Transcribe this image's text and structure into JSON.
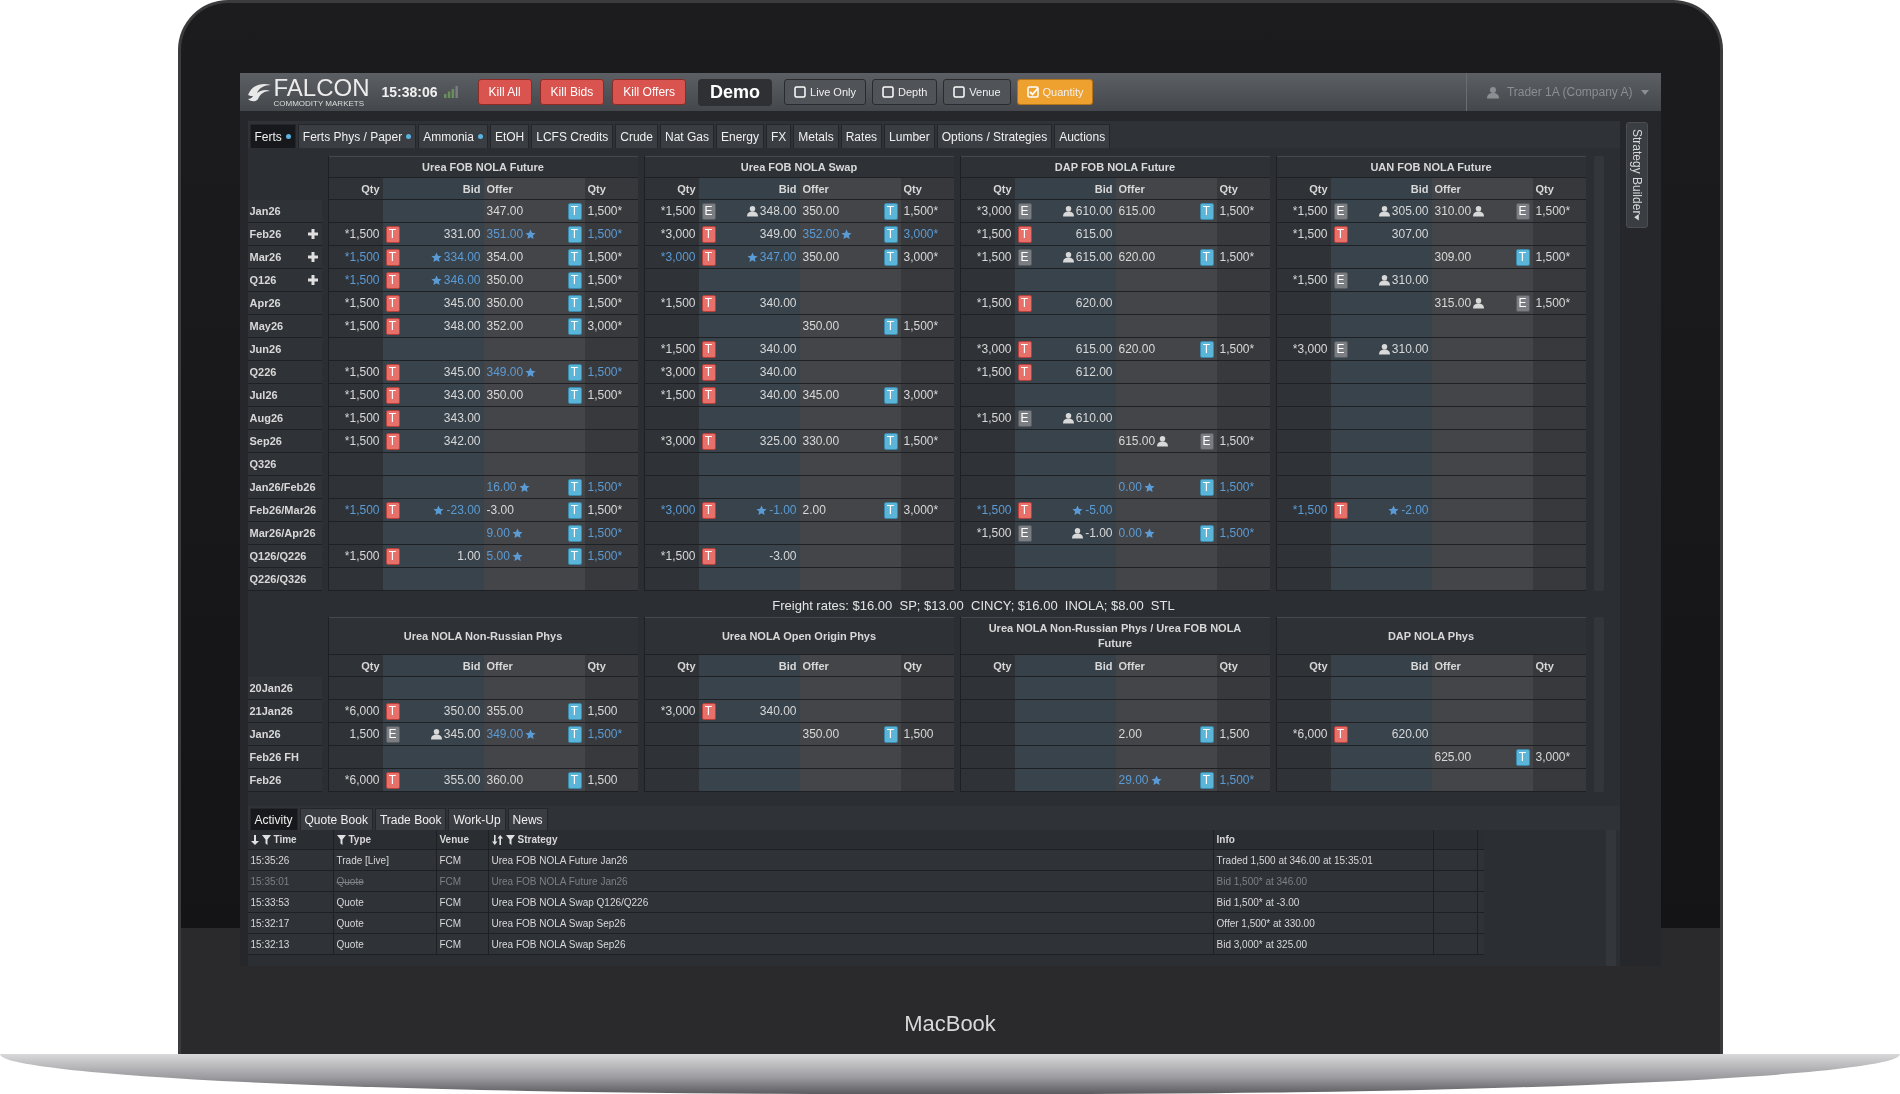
{
  "app": {
    "logo": {
      "name": "FALCON",
      "tagline": "COMMODITY MARKETS"
    },
    "clock": "15:38:06",
    "kill_buttons": [
      "Kill All",
      "Kill Bids",
      "Kill Offers"
    ],
    "mode": "Demo",
    "toggles": [
      {
        "label": "Live Only",
        "checked": false
      },
      {
        "label": "Depth",
        "checked": false
      },
      {
        "label": "Venue",
        "checked": false
      },
      {
        "label": "Quantity",
        "checked": true
      }
    ],
    "user": "Trader 1A (Company A)"
  },
  "tabs": [
    {
      "label": "Ferts",
      "selected": true,
      "alert": true
    },
    {
      "label": "Ferts Phys / Paper",
      "selected": false,
      "alert": true
    },
    {
      "label": "Ammonia",
      "selected": false,
      "alert": true
    },
    {
      "label": "EtOH",
      "selected": false,
      "alert": false
    },
    {
      "label": "LCFS Credits",
      "selected": false,
      "alert": false
    },
    {
      "label": "Crude",
      "selected": false,
      "alert": false
    },
    {
      "label": "Nat Gas",
      "selected": false,
      "alert": false
    },
    {
      "label": "Energy",
      "selected": false,
      "alert": false
    },
    {
      "label": "FX",
      "selected": false,
      "alert": false
    },
    {
      "label": "Metals",
      "selected": false,
      "alert": false
    },
    {
      "label": "Rates",
      "selected": false,
      "alert": false
    },
    {
      "label": "Lumber",
      "selected": false,
      "alert": false
    },
    {
      "label": "Options / Strategies",
      "selected": false,
      "alert": false
    },
    {
      "label": "Auctions",
      "selected": false,
      "alert": false
    }
  ],
  "side_panel": {
    "label": "Strategy Builder"
  },
  "upper": {
    "markets": [
      {
        "title": "Urea FOB NOLA Future",
        "columns": [
          "Qty",
          "Bid",
          "Offer",
          "Qty"
        ]
      },
      {
        "title": "Urea FOB NOLA Swap",
        "columns": [
          "Qty",
          "Bid",
          "Offer",
          "Qty"
        ]
      },
      {
        "title": "DAP FOB NOLA Future",
        "columns": [
          "Qty",
          "Bid",
          "Offer",
          "Qty"
        ]
      },
      {
        "title": "UAN FOB NOLA Future",
        "columns": [
          "Qty",
          "Bid",
          "Offer",
          "Qty"
        ]
      }
    ],
    "rows": [
      {
        "label": "Jan26",
        "expandable": false,
        "cells": [
          {
            "offer": {
              "price": "347.00",
              "tag": "T",
              "tag_muted": false,
              "qty": "1,500*"
            }
          },
          {
            "bid": {
              "qty": "*1,500",
              "tag": "E",
              "tag_muted": true,
              "price": "348.00",
              "kind": "named"
            },
            "offer": {
              "price": "350.00",
              "tag": "T",
              "tag_muted": false,
              "qty": "1,500*"
            }
          },
          {
            "bid": {
              "qty": "*3,000",
              "tag": "E",
              "tag_muted": true,
              "price": "610.00",
              "kind": "named"
            },
            "offer": {
              "price": "615.00",
              "tag": "T",
              "tag_muted": false,
              "qty": "1,500*"
            }
          },
          {
            "bid": {
              "qty": "*1,500",
              "tag": "E",
              "tag_muted": true,
              "price": "305.00",
              "kind": "named"
            },
            "offer": {
              "price": "310.00",
              "kind": "named",
              "tag": "E",
              "tag_muted": true,
              "qty": "1,500*"
            }
          }
        ]
      },
      {
        "label": "Feb26",
        "expandable": true,
        "cells": [
          {
            "bid": {
              "qty": "*1,500",
              "tag": "T",
              "tag_muted": false,
              "price": "331.00"
            },
            "offer": {
              "price": "351.00",
              "kind": "own",
              "tag": "T",
              "tag_muted": false,
              "qty": "1,500*"
            }
          },
          {
            "bid": {
              "qty": "*3,000",
              "tag": "T",
              "tag_muted": false,
              "price": "349.00"
            },
            "offer": {
              "price": "352.00",
              "kind": "own",
              "tag": "T",
              "tag_muted": false,
              "qty": "3,000*"
            }
          },
          {
            "bid": {
              "qty": "*1,500",
              "tag": "T",
              "tag_muted": false,
              "price": "615.00"
            }
          },
          {
            "bid": {
              "qty": "*1,500",
              "tag": "T",
              "tag_muted": false,
              "price": "307.00"
            }
          }
        ]
      },
      {
        "label": "Mar26",
        "expandable": true,
        "cells": [
          {
            "bid": {
              "qty": "*1,500",
              "tag": "T",
              "tag_muted": false,
              "price": "334.00",
              "kind": "own"
            },
            "offer": {
              "price": "354.00",
              "tag": "T",
              "tag_muted": false,
              "qty": "1,500*"
            }
          },
          {
            "bid": {
              "qty": "*3,000",
              "tag": "T",
              "tag_muted": false,
              "price": "347.00",
              "kind": "own"
            },
            "offer": {
              "price": "350.00",
              "tag": "T",
              "tag_muted": false,
              "qty": "3,000*"
            }
          },
          {
            "bid": {
              "qty": "*1,500",
              "tag": "E",
              "tag_muted": true,
              "price": "615.00",
              "kind": "named"
            },
            "offer": {
              "price": "620.00",
              "tag": "T",
              "tag_muted": false,
              "qty": "1,500*"
            }
          },
          {
            "offer": {
              "price": "309.00",
              "tag": "T",
              "tag_muted": false,
              "qty": "1,500*"
            }
          }
        ]
      },
      {
        "label": "Q126",
        "expandable": true,
        "cells": [
          {
            "bid": {
              "qty": "*1,500",
              "tag": "T",
              "tag_muted": false,
              "price": "346.00",
              "kind": "own"
            },
            "offer": {
              "price": "350.00",
              "tag": "T",
              "tag_muted": false,
              "qty": "1,500*"
            }
          },
          null,
          null,
          {
            "bid": {
              "qty": "*1,500",
              "tag": "E",
              "tag_muted": true,
              "price": "310.00",
              "kind": "named"
            }
          }
        ]
      },
      {
        "label": "Apr26",
        "expandable": false,
        "cells": [
          {
            "bid": {
              "qty": "*1,500",
              "tag": "T",
              "tag_muted": false,
              "price": "345.00"
            },
            "offer": {
              "price": "350.00",
              "tag": "T",
              "tag_muted": false,
              "qty": "1,500*"
            }
          },
          {
            "bid": {
              "qty": "*1,500",
              "tag": "T",
              "tag_muted": false,
              "price": "340.00"
            }
          },
          {
            "bid": {
              "qty": "*1,500",
              "tag": "T",
              "tag_muted": false,
              "price": "620.00"
            }
          },
          {
            "offer": {
              "price": "315.00",
              "kind": "named",
              "tag": "E",
              "tag_muted": true,
              "qty": "1,500*"
            }
          }
        ]
      },
      {
        "label": "May26",
        "expandable": false,
        "cells": [
          {
            "bid": {
              "qty": "*1,500",
              "tag": "T",
              "tag_muted": false,
              "price": "348.00"
            },
            "offer": {
              "price": "352.00",
              "tag": "T",
              "tag_muted": false,
              "qty": "3,000*"
            }
          },
          {
            "offer": {
              "price": "350.00",
              "tag": "T",
              "tag_muted": false,
              "qty": "1,500*"
            }
          },
          null,
          null
        ]
      },
      {
        "label": "Jun26",
        "expandable": false,
        "cells": [
          null,
          {
            "bid": {
              "qty": "*1,500",
              "tag": "T",
              "tag_muted": false,
              "price": "340.00"
            }
          },
          {
            "bid": {
              "qty": "*3,000",
              "tag": "T",
              "tag_muted": false,
              "price": "615.00"
            },
            "offer": {
              "price": "620.00",
              "tag": "T",
              "tag_muted": false,
              "qty": "1,500*"
            }
          },
          {
            "bid": {
              "qty": "*3,000",
              "tag": "E",
              "tag_muted": true,
              "price": "310.00",
              "kind": "named"
            }
          }
        ]
      },
      {
        "label": "Q226",
        "expandable": false,
        "cells": [
          {
            "bid": {
              "qty": "*1,500",
              "tag": "T",
              "tag_muted": false,
              "price": "345.00"
            },
            "offer": {
              "price": "349.00",
              "kind": "own",
              "tag": "T",
              "tag_muted": false,
              "qty": "1,500*"
            }
          },
          {
            "bid": {
              "qty": "*3,000",
              "tag": "T",
              "tag_muted": false,
              "price": "340.00"
            }
          },
          {
            "bid": {
              "qty": "*1,500",
              "tag": "T",
              "tag_muted": false,
              "price": "612.00"
            }
          },
          null
        ]
      },
      {
        "label": "Jul26",
        "expandable": false,
        "cells": [
          {
            "bid": {
              "qty": "*1,500",
              "tag": "T",
              "tag_muted": false,
              "price": "343.00"
            },
            "offer": {
              "price": "350.00",
              "tag": "T",
              "tag_muted": false,
              "qty": "1,500*"
            }
          },
          {
            "bid": {
              "qty": "*1,500",
              "tag": "T",
              "tag_muted": false,
              "price": "340.00"
            },
            "offer": {
              "price": "345.00",
              "tag": "T",
              "tag_muted": false,
              "qty": "3,000*"
            }
          },
          null,
          null
        ]
      },
      {
        "label": "Aug26",
        "expandable": false,
        "cells": [
          {
            "bid": {
              "qty": "*1,500",
              "tag": "T",
              "tag_muted": false,
              "price": "343.00"
            }
          },
          null,
          {
            "bid": {
              "qty": "*1,500",
              "tag": "E",
              "tag_muted": true,
              "price": "610.00",
              "kind": "named"
            }
          },
          null
        ]
      },
      {
        "label": "Sep26",
        "expandable": false,
        "cells": [
          {
            "bid": {
              "qty": "*1,500",
              "tag": "T",
              "tag_muted": false,
              "price": "342.00"
            }
          },
          {
            "bid": {
              "qty": "*3,000",
              "tag": "T",
              "tag_muted": false,
              "price": "325.00"
            },
            "offer": {
              "price": "330.00",
              "tag": "T",
              "tag_muted": false,
              "qty": "1,500*"
            }
          },
          {
            "offer": {
              "price": "615.00",
              "kind": "named",
              "tag": "E",
              "tag_muted": true,
              "qty": "1,500*"
            }
          },
          null
        ]
      },
      {
        "label": "Q326",
        "expandable": false,
        "cells": [
          null,
          null,
          null,
          null
        ]
      },
      {
        "label": "Jan26/Feb26",
        "expandable": false,
        "cells": [
          {
            "offer": {
              "price": "16.00",
              "kind": "own",
              "tag": "T",
              "tag_muted": false,
              "qty": "1,500*"
            }
          },
          null,
          {
            "offer": {
              "price": "0.00",
              "kind": "own",
              "tag": "T",
              "tag_muted": false,
              "qty": "1,500*"
            }
          },
          null
        ]
      },
      {
        "label": "Feb26/Mar26",
        "expandable": false,
        "cells": [
          {
            "bid": {
              "qty": "*1,500",
              "tag": "T",
              "tag_muted": false,
              "price": "-23.00",
              "kind": "own"
            },
            "offer": {
              "price": "-3.00",
              "tag": "T",
              "tag_muted": false,
              "qty": "1,500*"
            }
          },
          {
            "bid": {
              "qty": "*3,000",
              "tag": "T",
              "tag_muted": false,
              "price": "-1.00",
              "kind": "own"
            },
            "offer": {
              "price": "2.00",
              "tag": "T",
              "tag_muted": false,
              "qty": "3,000*"
            }
          },
          {
            "bid": {
              "qty": "*1,500",
              "tag": "T",
              "tag_muted": false,
              "price": "-5.00",
              "kind": "own"
            }
          },
          {
            "bid": {
              "qty": "*1,500",
              "tag": "T",
              "tag_muted": false,
              "price": "-2.00",
              "kind": "own"
            }
          }
        ]
      },
      {
        "label": "Mar26/Apr26",
        "expandable": false,
        "cells": [
          {
            "offer": {
              "price": "9.00",
              "kind": "own",
              "tag": "T",
              "tag_muted": false,
              "qty": "1,500*"
            }
          },
          null,
          {
            "bid": {
              "qty": "*1,500",
              "tag": "E",
              "tag_muted": true,
              "price": "-1.00",
              "kind": "named"
            },
            "offer": {
              "price": "0.00",
              "kind": "own",
              "tag": "T",
              "tag_muted": false,
              "qty": "1,500*"
            }
          },
          null
        ]
      },
      {
        "label": "Q126/Q226",
        "expandable": false,
        "cells": [
          {
            "bid": {
              "qty": "*1,500",
              "tag": "T",
              "tag_muted": false,
              "price": "1.00"
            },
            "offer": {
              "price": "5.00",
              "kind": "own",
              "tag": "T",
              "tag_muted": false,
              "qty": "1,500*"
            }
          },
          {
            "bid": {
              "qty": "*1,500",
              "tag": "T",
              "tag_muted": false,
              "price": "-3.00"
            }
          },
          null,
          null
        ]
      },
      {
        "label": "Q226/Q326",
        "expandable": false,
        "cells": [
          null,
          null,
          null,
          null
        ]
      }
    ]
  },
  "freight": "Freight rates: $16.00  SP; $13.00  CINCY; $16.00  INOLA; $8.00  STL",
  "lower": {
    "markets": [
      {
        "title": "Urea NOLA Non-Russian Phys",
        "columns": [
          "Qty",
          "Bid",
          "Offer",
          "Qty"
        ]
      },
      {
        "title": "Urea NOLA Open Origin Phys",
        "columns": [
          "Qty",
          "Bid",
          "Offer",
          "Qty"
        ]
      },
      {
        "title": "Urea NOLA Non-Russian Phys / Urea FOB NOLA Future",
        "columns": [
          "Qty",
          "Bid",
          "Offer",
          "Qty"
        ]
      },
      {
        "title": "DAP NOLA Phys",
        "columns": [
          "Qty",
          "Bid",
          "Offer",
          "Qty"
        ]
      }
    ],
    "rows": [
      {
        "label": "20Jan26",
        "expandable": false,
        "cells": [
          null,
          null,
          null,
          null
        ]
      },
      {
        "label": "21Jan26",
        "expandable": false,
        "cells": [
          {
            "bid": {
              "qty": "*6,000",
              "tag": "T",
              "tag_muted": false,
              "price": "350.00"
            },
            "offer": {
              "price": "355.00",
              "tag": "T",
              "tag_muted": false,
              "qty": "1,500"
            }
          },
          {
            "bid": {
              "qty": "*3,000",
              "tag": "T",
              "tag_muted": false,
              "price": "340.00"
            }
          },
          null,
          null
        ]
      },
      {
        "label": "Jan26",
        "expandable": false,
        "cells": [
          {
            "bid": {
              "qty": "1,500",
              "tag": "E",
              "tag_muted": true,
              "price": "345.00",
              "kind": "named"
            },
            "offer": {
              "price": "349.00",
              "kind": "own",
              "tag": "T",
              "tag_muted": false,
              "qty": "1,500*"
            }
          },
          {
            "offer": {
              "price": "350.00",
              "tag": "T",
              "tag_muted": false,
              "qty": "1,500"
            }
          },
          {
            "offer": {
              "price": "2.00",
              "tag": "T",
              "tag_muted": false,
              "qty": "1,500"
            }
          },
          {
            "bid": {
              "qty": "*6,000",
              "tag": "T",
              "tag_muted": false,
              "price": "620.00"
            }
          }
        ]
      },
      {
        "label": "Feb26 FH",
        "expandable": false,
        "cells": [
          null,
          null,
          null,
          {
            "offer": {
              "price": "625.00",
              "tag": "T",
              "tag_muted": false,
              "qty": "3,000*"
            }
          }
        ]
      },
      {
        "label": "Feb26",
        "expandable": false,
        "cells": [
          {
            "bid": {
              "qty": "*6,000",
              "tag": "T",
              "tag_muted": false,
              "price": "355.00"
            },
            "offer": {
              "price": "360.00",
              "tag": "T",
              "tag_muted": false,
              "qty": "1,500"
            }
          },
          null,
          {
            "offer": {
              "price": "29.00",
              "kind": "own",
              "tag": "T",
              "tag_muted": false,
              "qty": "1,500*"
            }
          },
          null
        ]
      }
    ]
  },
  "activity": {
    "tabs": [
      {
        "label": "Activity",
        "selected": true
      },
      {
        "label": "Quote Book",
        "selected": false
      },
      {
        "label": "Trade Book",
        "selected": false
      },
      {
        "label": "Work-Up",
        "selected": false
      },
      {
        "label": "News",
        "selected": false
      }
    ],
    "columns": [
      {
        "label": "Time",
        "kind": "sorted",
        "filter": true
      },
      {
        "label": "Type",
        "kind": "plain",
        "filter": true
      },
      {
        "label": "Venue",
        "kind": "plain",
        "filter": false
      },
      {
        "label": "Strategy",
        "kind": "sortable",
        "filter": true
      },
      {
        "label": "Info",
        "kind": "plain",
        "filter": false
      }
    ],
    "rows": [
      {
        "time": "15:35:26",
        "type": "Trade [Live]",
        "venue": "FCM",
        "strategy": "Urea FOB NOLA Future Jan26",
        "info": "Traded 1,500 at 346.00 at 15:35:01",
        "cancelled": false
      },
      {
        "time": "15:35:01",
        "type": "Quote",
        "venue": "FCM",
        "strategy": "Urea FOB NOLA Future Jan26",
        "info": "Bid 1,500* at 346.00",
        "cancelled": true
      },
      {
        "time": "15:33:53",
        "type": "Quote",
        "venue": "FCM",
        "strategy": "Urea FOB NOLA Swap Q126/Q226",
        "info": "Bid 1,500* at -3.00",
        "cancelled": false
      },
      {
        "time": "15:32:17",
        "type": "Quote",
        "venue": "FCM",
        "strategy": "Urea FOB NOLA Swap Sep26",
        "info": "Offer 1,500* at 330.00",
        "cancelled": false
      },
      {
        "time": "15:32:13",
        "type": "Quote",
        "venue": "FCM",
        "strategy": "Urea FOB NOLA Swap Sep26",
        "info": "Bid 3,000* at 325.00",
        "cancelled": false
      }
    ]
  },
  "device": {
    "label": "MacBook"
  }
}
